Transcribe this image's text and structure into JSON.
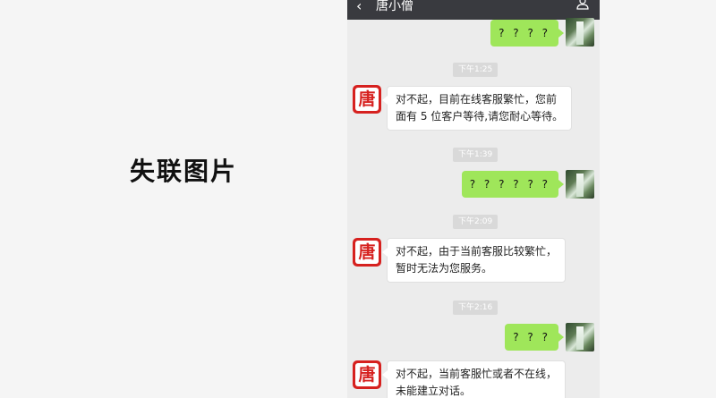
{
  "left_label": "失联图片",
  "chat": {
    "title": "唐小僧",
    "avatar_char": "唐",
    "messages": [
      {
        "type": "out",
        "text": "? ? ? ?"
      },
      {
        "type": "time",
        "text": "下午1:25"
      },
      {
        "type": "in",
        "lines": [
          "对不起，目前在线客服繁忙，您前",
          "面有 5 位客户等待,请您耐心等待。"
        ]
      },
      {
        "type": "time",
        "text": "下午1:39"
      },
      {
        "type": "out",
        "text": "? ? ? ? ? ?"
      },
      {
        "type": "time",
        "text": "下午2:09"
      },
      {
        "type": "in",
        "lines": [
          "对不起，由于当前客服比较繁忙，",
          "暂时无法为您服务。"
        ]
      },
      {
        "type": "time",
        "text": "下午2:16"
      },
      {
        "type": "out",
        "text": "? ? ?"
      },
      {
        "type": "in",
        "lines": [
          "对不起，当前客服忙或者不在线，",
          "未能建立对话。"
        ]
      }
    ]
  },
  "colors": {
    "topbar": "#393a3f",
    "chat_bg": "#ececec",
    "outgoing_bubble": "#9fe65a",
    "avatar_red": "#d6211f"
  },
  "icons": {
    "back": "chevron-left-icon",
    "contact": "person-icon"
  }
}
